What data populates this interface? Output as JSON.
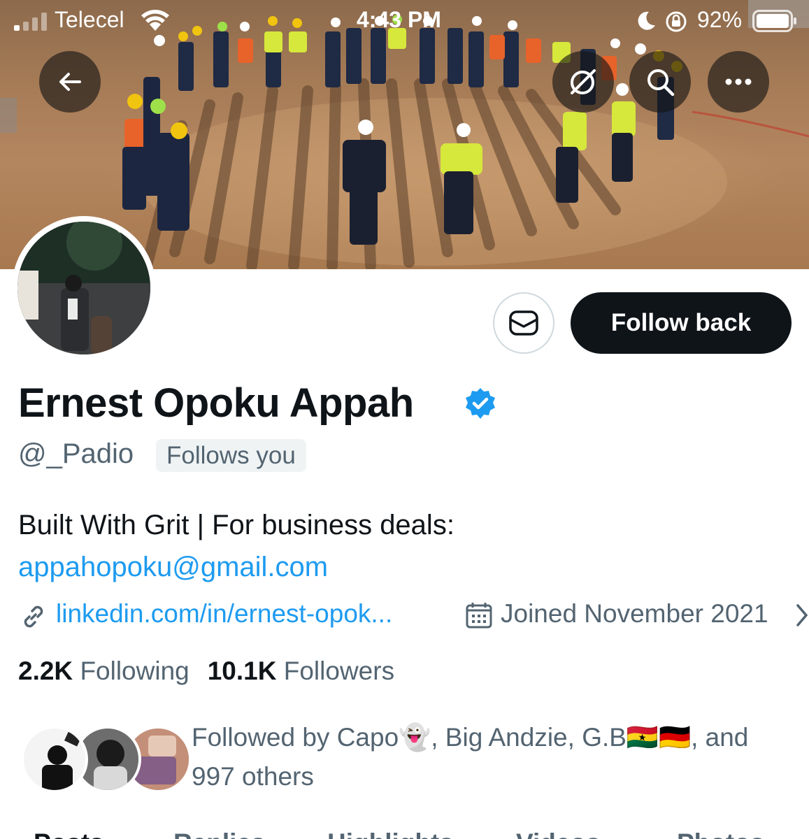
{
  "status_bar": {
    "carrier": "Telecel",
    "time": "4:43 PM",
    "battery": "92%"
  },
  "icons": {
    "back": "arrow-left-icon",
    "grok": "grok-icon",
    "search": "search-icon",
    "more": "more-icon",
    "message": "envelope-icon",
    "verified": "verified-badge-icon",
    "link": "link-icon",
    "calendar": "calendar-icon"
  },
  "colors": {
    "accent": "#1d9bf0",
    "text": "#0f1419",
    "muted": "#536471",
    "button": "#0f1419"
  },
  "profile": {
    "follow_label": "Follow back",
    "name": "Ernest Opoku Appah",
    "handle": "@_Padio",
    "follows_you": "Follows you",
    "bio_text": "Built With Grit | For business deals:",
    "bio_email": "appahopoku@gmail.com",
    "link": "linkedin.com/in/ernest-opok...",
    "joined": "Joined November 2021",
    "following_count": "2.2K",
    "following_label": "Following",
    "followers_count": "10.1K",
    "followers_label": "Followers",
    "followed_by_line1": "Followed by Capo👻, Big Andzie, G.B🇬🇭🇩🇪, and",
    "followed_by_line2": "997 others"
  },
  "tabs": [
    "Posts",
    "Replies",
    "Highlights",
    "Videos",
    "Photos"
  ]
}
